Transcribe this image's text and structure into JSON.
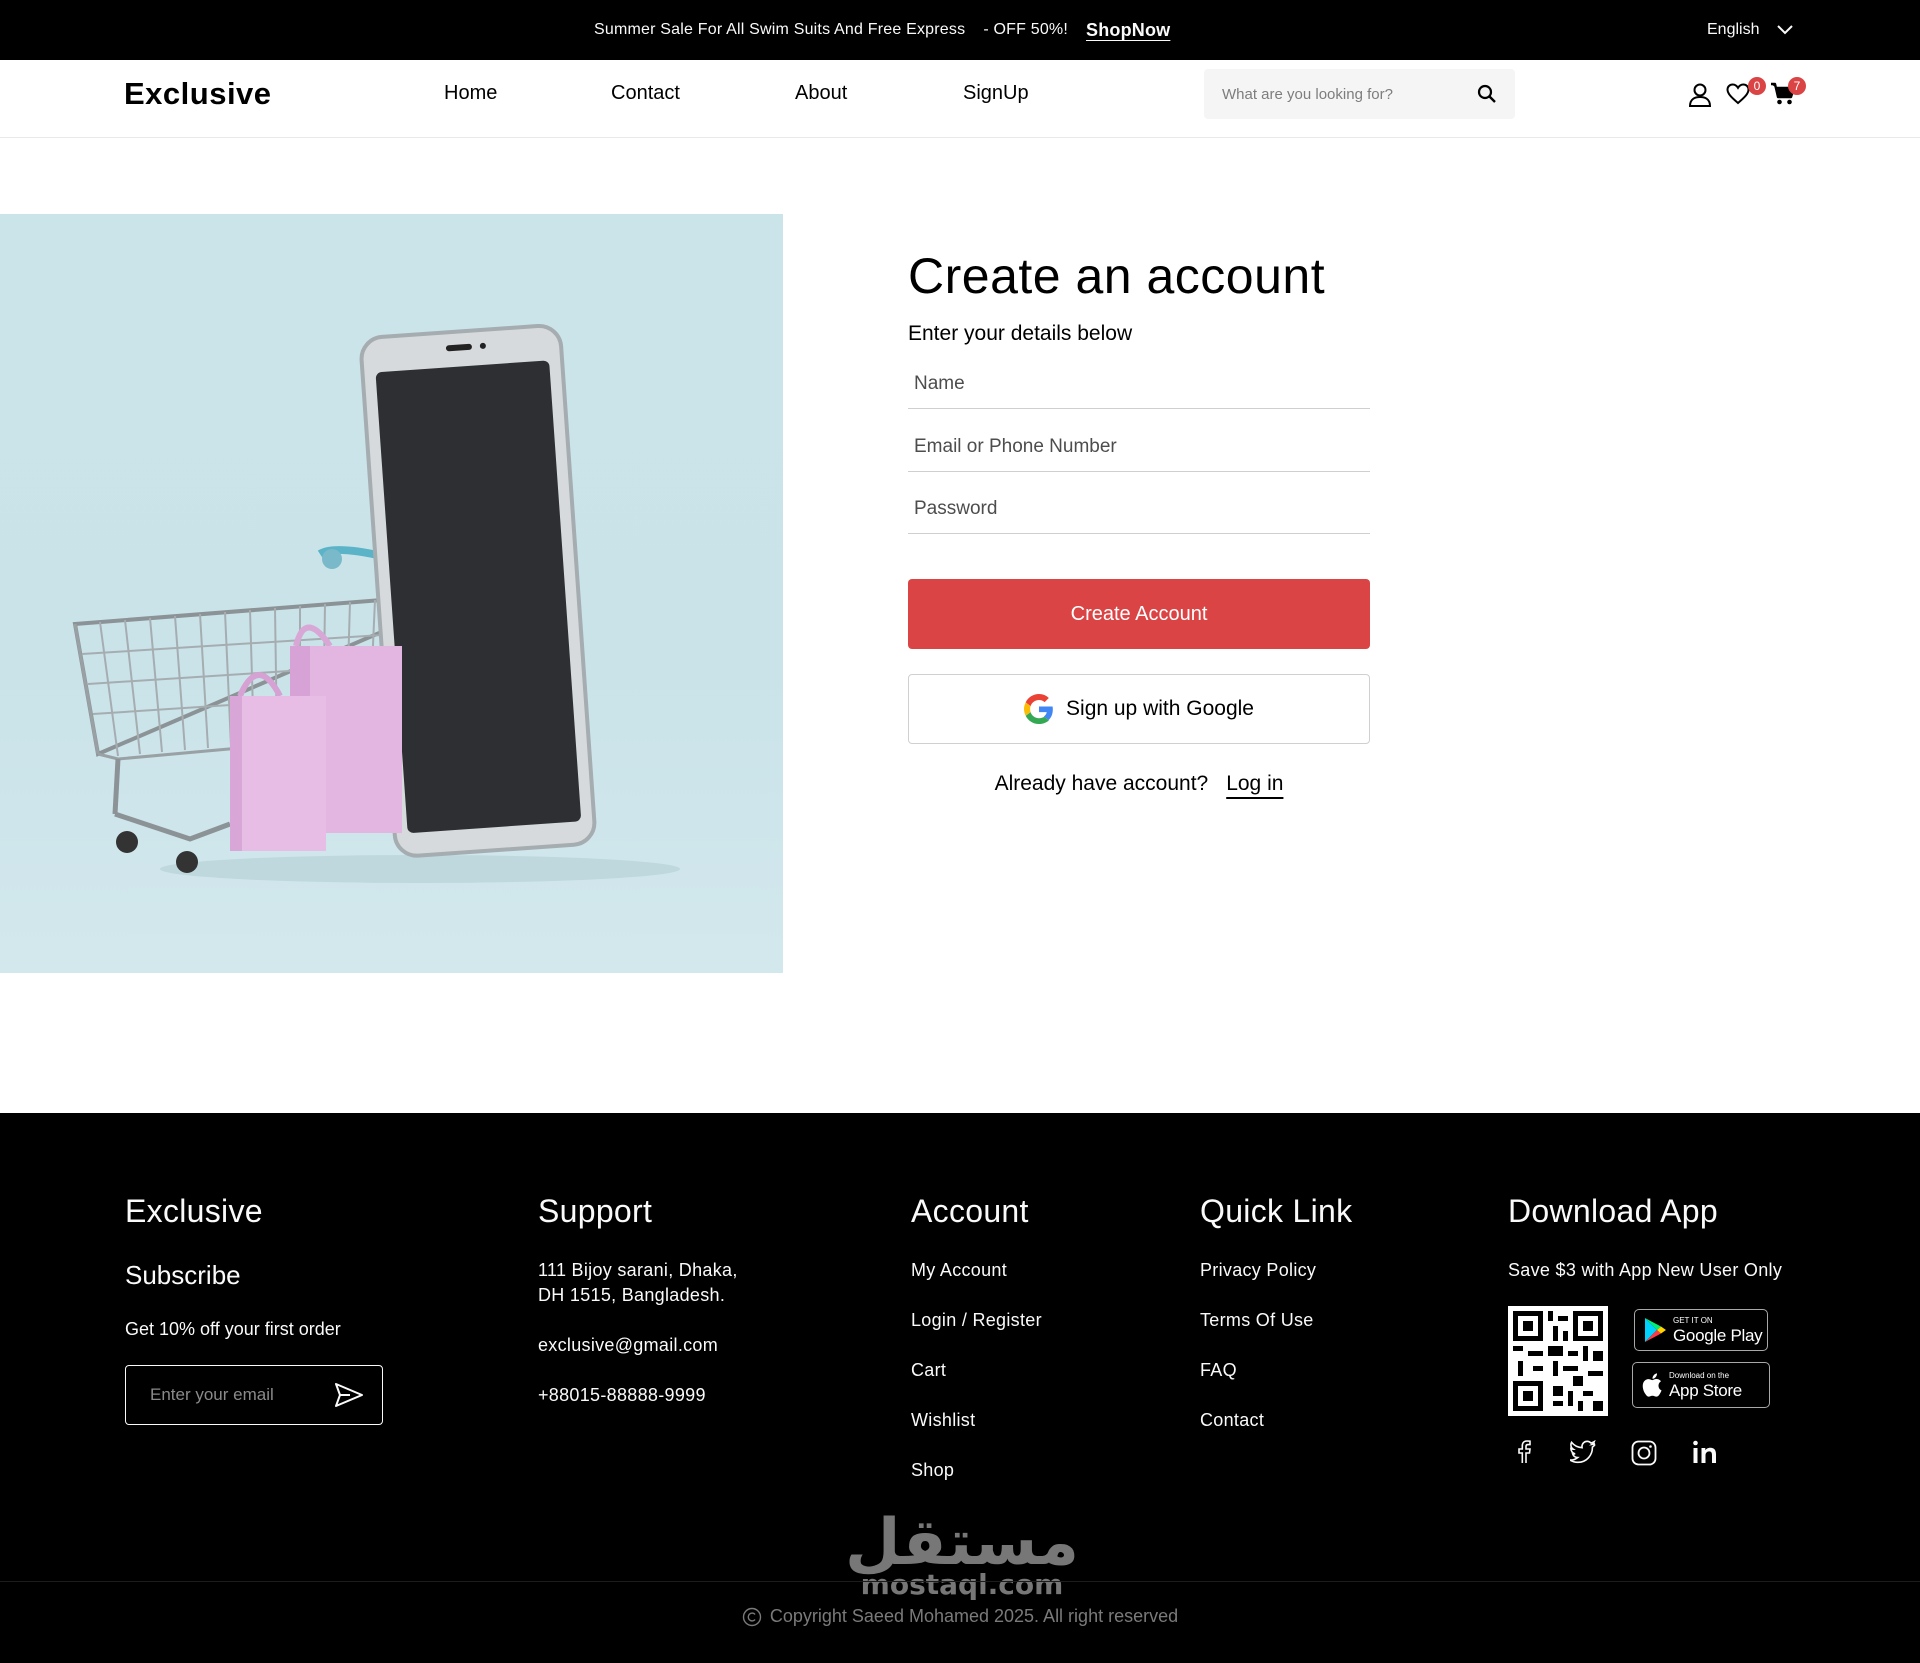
{
  "topbar": {
    "promo_text": "Summer Sale For All Swim Suits And Free Express",
    "promo_offer": "- OFF 50%!",
    "shop_now": "ShopNow",
    "language": "English"
  },
  "header": {
    "logo": "Exclusive",
    "nav": [
      "Home",
      "Contact",
      "About",
      "SignUp"
    ],
    "search_placeholder": "What are you looking for?",
    "wishlist_count": "0",
    "cart_count": "7"
  },
  "form": {
    "title": "Create an account",
    "subtitle": "Enter your details below",
    "name_placeholder": "Name",
    "email_placeholder": "Email or Phone Number",
    "password_placeholder": "Password",
    "create_button": "Create Account",
    "google_button": "Sign up with Google",
    "already_text": "Already have account?",
    "login_link": "Log in"
  },
  "footer": {
    "brand": {
      "title": "Exclusive",
      "subscribe_title": "Subscribe",
      "subscribe_text": "Get 10% off your first order",
      "email_placeholder": "Enter your email"
    },
    "support": {
      "title": "Support",
      "address_line1": "111 Bijoy sarani, Dhaka,",
      "address_line2": "DH 1515, Bangladesh.",
      "email": "exclusive@gmail.com",
      "phone": "+88015-88888-9999"
    },
    "account": {
      "title": "Account",
      "links": [
        "My Account",
        "Login / Register",
        "Cart",
        "Wishlist",
        "Shop"
      ]
    },
    "quick_link": {
      "title": "Quick Link",
      "links": [
        "Privacy Policy",
        "Terms Of Use",
        "FAQ",
        "Contact"
      ]
    },
    "download": {
      "title": "Download App",
      "text": "Save $3 with App New User Only",
      "google_play_small": "GET IT ON",
      "google_play_big": "Google Play",
      "app_store_small": "Download on the",
      "app_store_big": "App Store"
    },
    "social_icons": [
      "facebook-icon",
      "twitter-icon",
      "instagram-icon",
      "linkedin-icon"
    ],
    "copyright": "Copyright Saeed Mohamed 2025. All right reserved",
    "watermark": "مستقل",
    "watermark_latin": "mostaql.com"
  },
  "colors": {
    "accent": "#DB4444",
    "topbar_bg": "#000000",
    "footer_bg": "#000000",
    "hero_bg": "#CBE4EA"
  }
}
